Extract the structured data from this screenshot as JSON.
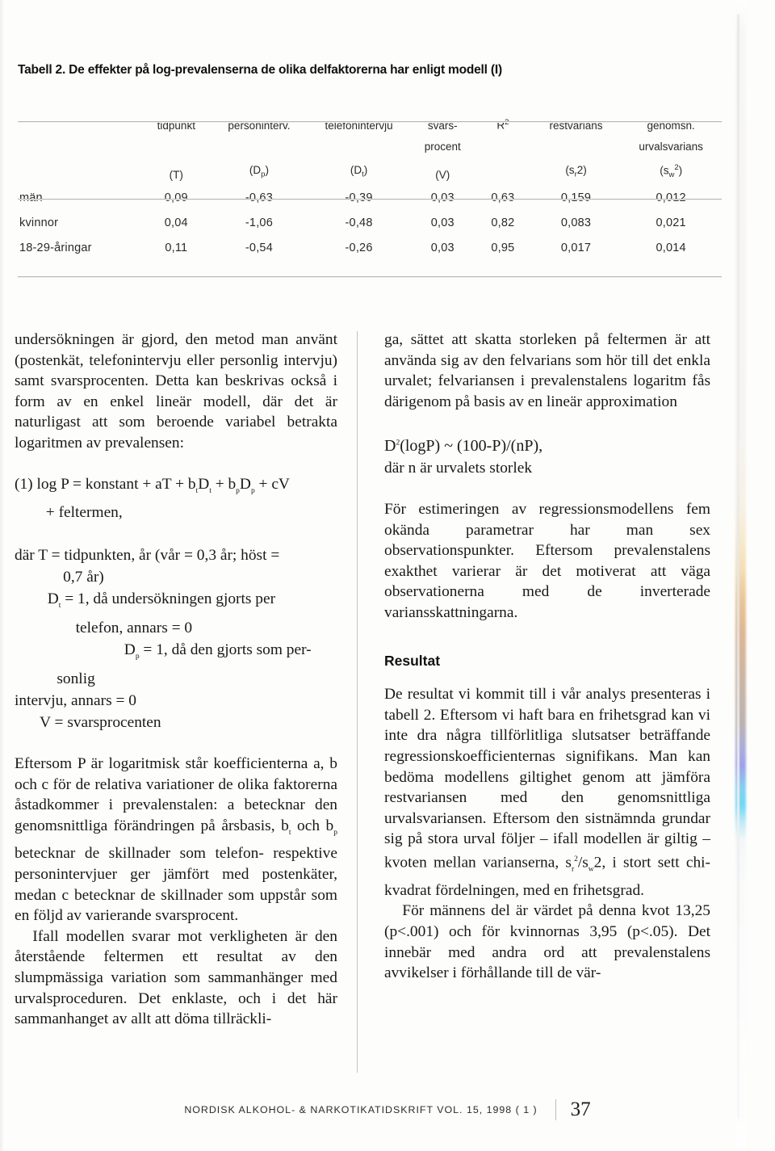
{
  "table": {
    "title": "Tabell 2. De effekter på log-prevalenserna de olika delfaktorerna har enligt modell (I)",
    "header_line1": [
      "",
      "tidpunkt",
      "personinterv.",
      "telefonintervju",
      "svars-",
      "R",
      "restvarians",
      "genomsn."
    ],
    "header_line2": [
      "",
      "",
      "",
      "",
      "procent",
      "",
      "",
      "urvalsvarians"
    ],
    "header_symbols": {
      "t": "(T)",
      "dp_open": "(D",
      "dp_sub": "p",
      "dp_close": ")",
      "dt_open": "(D",
      "dt_sub": "t",
      "dt_close": ")",
      "v": "(V)",
      "sr_open": "(s",
      "sr_sub": "r",
      "sr_sup": "2",
      "sr_close": ")",
      "sw_open": "(s",
      "sw_sub": "w",
      "sw_sup": "2",
      "sw_close": ")",
      "r2_sup": "2"
    },
    "rows": [
      {
        "label": "män",
        "tidpunkt": "0,09",
        "personinterv": "-0,63",
        "telefonintervju": "-0,39",
        "svarsprocent": "0,03",
        "r2": "0,63",
        "restvarians": "0,159",
        "urvalsvarians": "0,012"
      },
      {
        "label": "kvinnor",
        "tidpunkt": "0,04",
        "personinterv": "-1,06",
        "telefonintervju": "-0,48",
        "svarsprocent": "0,03",
        "r2": "0,82",
        "restvarians": "0,083",
        "urvalsvarians": "0,021"
      },
      {
        "label": "18-29-åringar",
        "tidpunkt": "0,11",
        "personinterv": "-0,54",
        "telefonintervju": "-0,26",
        "svarsprocent": "0,03",
        "r2": "0,95",
        "restvarians": "0,017",
        "urvalsvarians": "0,014"
      }
    ]
  },
  "left_column": {
    "para1": "undersökningen är gjord, den metod man använt (postenkät, telefonintervju eller personlig intervju) samt svarsprocenten. Detta kan beskrivas också i form av en enkel lineär modell, där det är naturligast att som beroende variabel betrakta logaritmen av prevalensen:",
    "equation": {
      "line1_a": "(1) log P = konstant + aT + b",
      "line1_sub1": "t",
      "line1_b": "D",
      "line1_sub2": "t",
      "line1_c": " + b",
      "line1_sub3": "p",
      "line1_d": "D",
      "line1_sub4": "p",
      "line1_e": " + cV",
      "line2": "+ feltermen,"
    },
    "where_block": {
      "l1": "där   T = tidpunkten, år (vår = 0,3 år; höst =",
      "l2": "0,7 år)",
      "l3_a": "D",
      "l3_sub": "t",
      "l3_b": " = 1, då undersökningen gjorts per",
      "l4": "telefon, annars = 0",
      "l5_a": "D",
      "l5_sub": "p",
      "l5_b": " = 1, då den gjorts som per-",
      "l6": "sonlig",
      "l7": "intervju, annars = 0",
      "l8": "V = svarsprocenten"
    },
    "para2_a": "Eftersom P är logaritmisk står koefficienterna a, b och c för de relativa variationer de olika faktorerna åstadkommer i prevalenstalen: a betecknar den genomsnittliga förändringen på årsbasis, b",
    "para2_sub1": "t",
    "para2_b": " och b",
    "para2_sub2": "p",
    "para2_c": " betecknar de skillnader som telefon- respektive personintervjuer ger jämfört med postenkäter, medan c betecknar de skillnader som uppstår som en följd av varierande svarsprocent.",
    "para3": "Ifall modellen svarar mot verkligheten är den återstående feltermen ett resultat av den slumpmässiga variation som sammanhänger med urvalsproceduren. Det enklaste, och i det här sammanhanget av allt att döma tillräckli-"
  },
  "right_column": {
    "para1": "ga, sättet att skatta storleken på feltermen är att använda sig av den felvarians som hör till det enkla urvalet; felvariansen i prevalenstalens logaritm fås därigenom på basis av en lineär approximation",
    "equation2": {
      "l1_a": "D",
      "l1_sup": "2",
      "l1_b": "(logP)  ~  (100-P)/(nP),",
      "l2": "där n är urvalets storlek"
    },
    "para2": "För estimeringen av regressionsmodellens fem okända parametrar har man sex observationspunkter. Eftersom prevalenstalens exakthet varierar är det motiverat att väga observationerna med de inverterade variansskattningarna.",
    "section_heading": "Resultat",
    "para3": "De resultat vi kommit till i vår analys presenteras i tabell 2. Eftersom vi haft bara en frihetsgrad kan vi inte dra några tillförlitliga slutsatser beträffande regressionskoefficienternas signifikans. Man kan bedöma modellens giltighet genom att jämföra restvariansen med den genomsnittliga urvalsvariansen. Eftersom den sistnämnda grundar sig på stora urval följer – ifall modellen är giltig – kvoten mellan varianserna, s",
    "para3_sub1": "r",
    "para3_sup1": "2",
    "para3_b": "/s",
    "para3_sub2": "w",
    "para3_c": "2, i stort sett chi-kvadrat fördelningen, med en frihetsgrad.",
    "para4": "För männens del är värdet på denna kvot 13,25 (p<.001) och för kvinnornas 3,95 (p<.05). Det innebär med andra ord att prevalenstalens avvikelser i förhållande till de vär-"
  },
  "footer": {
    "journal": "NORDISK ALKOHOL- & NARKOTIKATIDSKRIFT  VOL. 15, 1998 ( 1 )",
    "page_number": "37"
  }
}
